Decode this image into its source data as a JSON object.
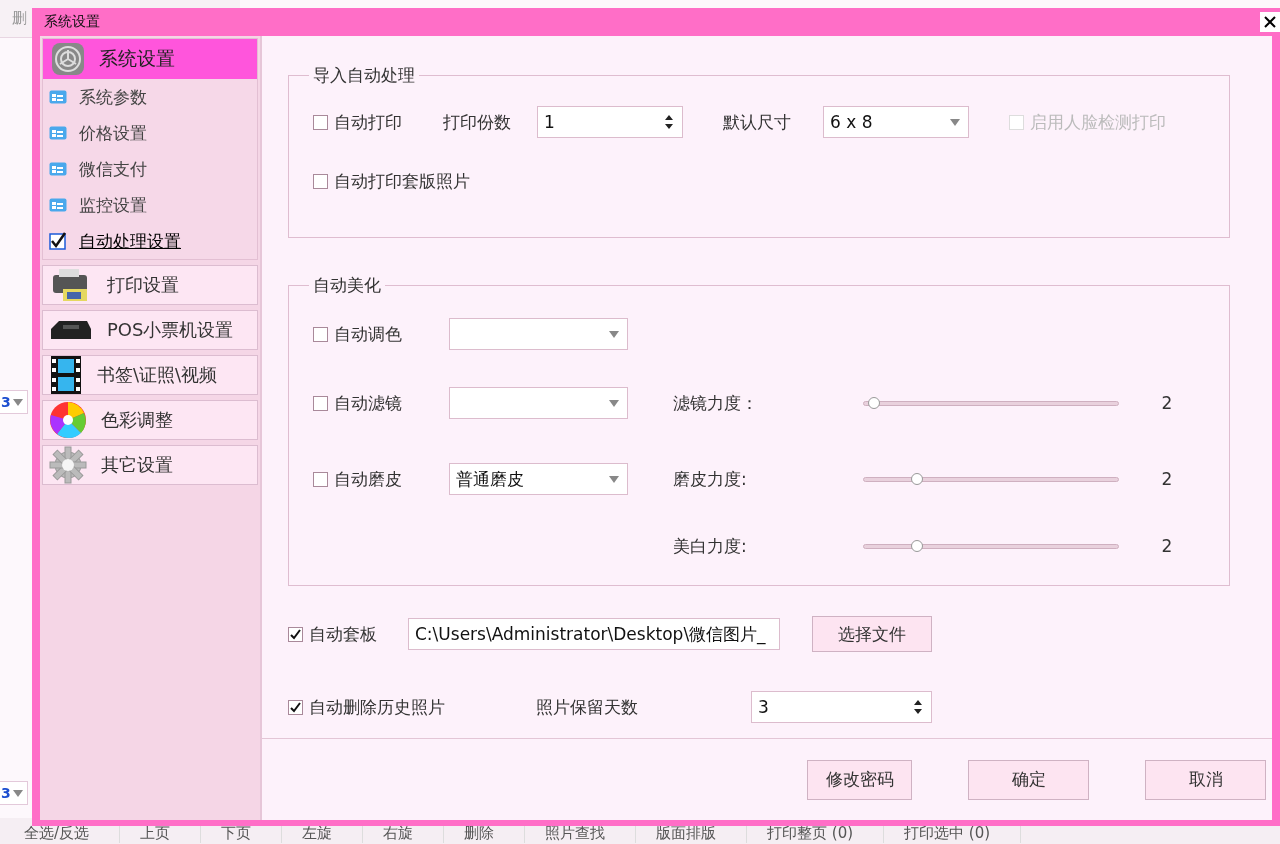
{
  "background_app": {
    "top_text": "删",
    "dropdowns": [
      "3",
      "3"
    ],
    "toolbar": [
      "全选/反选",
      "上页",
      "下页",
      "左旋",
      "右旋",
      "删除",
      "照片查找",
      "版面排版",
      "打印整页 (0)",
      "打印选中 (0)"
    ]
  },
  "dialog": {
    "title": "系统设置",
    "sidebar": {
      "header": "系统设置",
      "items": [
        {
          "label": "系统参数",
          "kind": "page",
          "selected": false
        },
        {
          "label": "价格设置",
          "kind": "page",
          "selected": false
        },
        {
          "label": "微信支付",
          "kind": "page",
          "selected": false
        },
        {
          "label": "监控设置",
          "kind": "page",
          "selected": false
        },
        {
          "label": "自动处理设置",
          "kind": "check",
          "selected": true
        }
      ],
      "groups": [
        {
          "label": "打印设置",
          "kind": "printer"
        },
        {
          "label": "POS小票机设置",
          "kind": "pos"
        },
        {
          "label": "书签\\证照\\视频",
          "kind": "film"
        },
        {
          "label": "色彩调整",
          "kind": "color"
        },
        {
          "label": "其它设置",
          "kind": "gear"
        }
      ]
    },
    "import_group": {
      "title": "导入自动处理",
      "auto_print": {
        "label": "自动打印",
        "checked": false
      },
      "copies": {
        "label": "打印份数",
        "value": "1"
      },
      "size": {
        "label": "默认尺寸",
        "value": "6 x 8"
      },
      "face_detect": {
        "label": "启用人脸检测打印",
        "checked": false,
        "disabled": true
      },
      "auto_template_print": {
        "label": "自动打印套版照片",
        "checked": false
      }
    },
    "beauty_group": {
      "title": "自动美化",
      "auto_tone": {
        "label": "自动调色",
        "checked": false
      },
      "auto_filter": {
        "label": "自动滤镜",
        "checked": false
      },
      "auto_skin": {
        "label": "自动磨皮",
        "checked": false,
        "value": "普通磨皮"
      },
      "sliders": [
        {
          "label": "滤镜力度：",
          "level": 0.04,
          "reading": "2"
        },
        {
          "label": "磨皮力度:",
          "level": 0.21,
          "reading": "2"
        },
        {
          "label": "美白力度:",
          "level": 0.21,
          "reading": "2"
        }
      ]
    },
    "auto_template": {
      "label": "自动套板",
      "checked": true,
      "path": "C:\\Users\\Administrator\\Desktop\\微信图片_",
      "button": "选择文件"
    },
    "auto_delete": {
      "label": "自动删除历史照片",
      "checked": true,
      "days_label": "照片保留天数",
      "days": "3"
    },
    "buttons": [
      "修改密码",
      "确定",
      "取消"
    ]
  }
}
